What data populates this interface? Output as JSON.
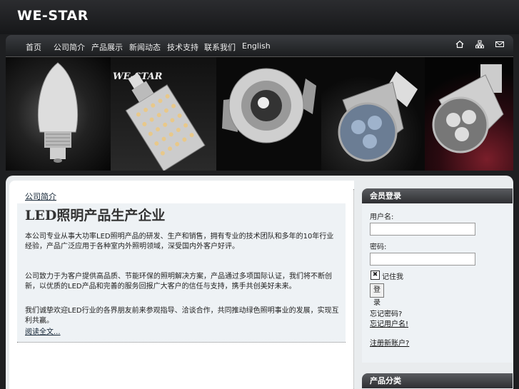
{
  "header": {
    "logo": "WE-STAR"
  },
  "nav": {
    "items": [
      "首页",
      "公司简介",
      "产品展示",
      "新闻动态",
      "技术支持",
      "联系我们",
      "English"
    ],
    "icons": [
      "home-icon",
      "sitemap-icon",
      "mail-icon"
    ]
  },
  "banner": {
    "brand_text": "WE-STAR"
  },
  "main": {
    "section_label": "公司简介",
    "article": {
      "title": "LED照明产品生产企业",
      "p1": "本公司专业从事大功率LED照明产品的研发、生产和销售，拥有专业的技术团队和多年的10年行业经验，产品广泛应用于各种室内外照明领域，深受国内外客户好评。",
      "p2": "公司致力于为客户提供高品质、节能环保的照明解决方案，产品通过多项国际认证，我们将不断创新，以优质的LED产品和完善的服务回报广大客户的信任与支持，携手共创美好未来。",
      "p3": "我们诚挚欢迎LED行业的各界朋友前来参观指导、洽谈合作，共同推动绿色照明事业的发展，实现互利共赢。",
      "read_more": "阅读全文..."
    }
  },
  "sidebar": {
    "login": {
      "title": "会员登录",
      "username_label": "用户名:",
      "password_label": "密码:",
      "remember_label": "记住我",
      "remember_checked": true,
      "submit_label": "登录",
      "forgot_password": "忘记密码?",
      "forgot_username": "忘记用户名!",
      "register": "注册新账户?"
    },
    "second_box_title": "产品分类"
  },
  "colors": {
    "header_bg": "#1e1f21",
    "panel_bg": "#eef2f5",
    "box_head": "#2e2f32"
  }
}
